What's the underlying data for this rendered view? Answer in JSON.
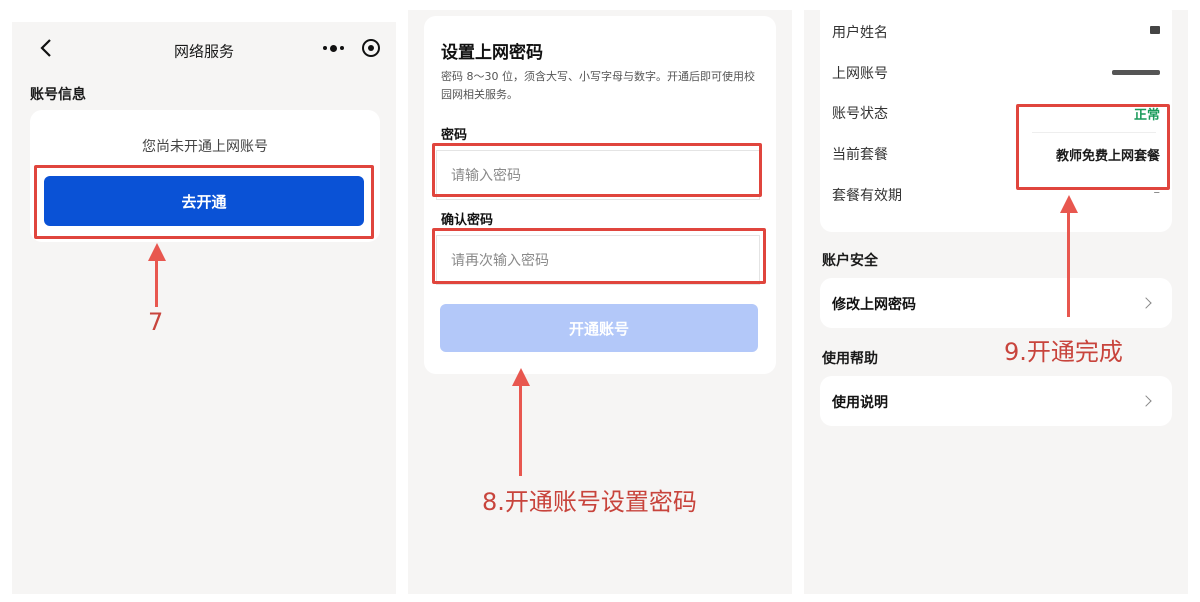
{
  "panel1": {
    "navbar": {
      "title": "网络服务"
    },
    "section_title": "账号信息",
    "card": {
      "message": "您尚未开通上网账号",
      "button_label": "去开通"
    },
    "step_label": "7"
  },
  "panel2": {
    "heading": "设置上网密码",
    "description": "密码 8～30 位，须含大写、小写字母与数字。开通后即可使用校园网相关服务。",
    "password_label": "密码",
    "password_placeholder": "请输入密码",
    "confirm_label": "确认密码",
    "confirm_placeholder": "请再次输入密码",
    "submit_label": "开通账号",
    "step_label": "8.开通账号设置密码"
  },
  "panel3": {
    "info_rows": [
      {
        "label": "用户姓名",
        "value": ""
      },
      {
        "label": "上网账号",
        "value": ""
      },
      {
        "label": "账号状态",
        "value": "正常"
      },
      {
        "label": "当前套餐",
        "value": "教师免费上网套餐"
      },
      {
        "label": "套餐有效期",
        "value": "–"
      }
    ],
    "security_title": "账户安全",
    "change_password_label": "修改上网密码",
    "help_title": "使用帮助",
    "instructions_label": "使用说明",
    "step_label": "9.开通完成"
  },
  "colors": {
    "primary": "#0a52d6",
    "disabled": "#b3c8f9",
    "annotation_red": "#e0453d",
    "status_ok": "#1a9a5a"
  },
  "icons": [
    "back-arrow-icon",
    "more-dots-icon",
    "target-circle-icon",
    "chevron-right-icon",
    "arrow-up-icon"
  ]
}
